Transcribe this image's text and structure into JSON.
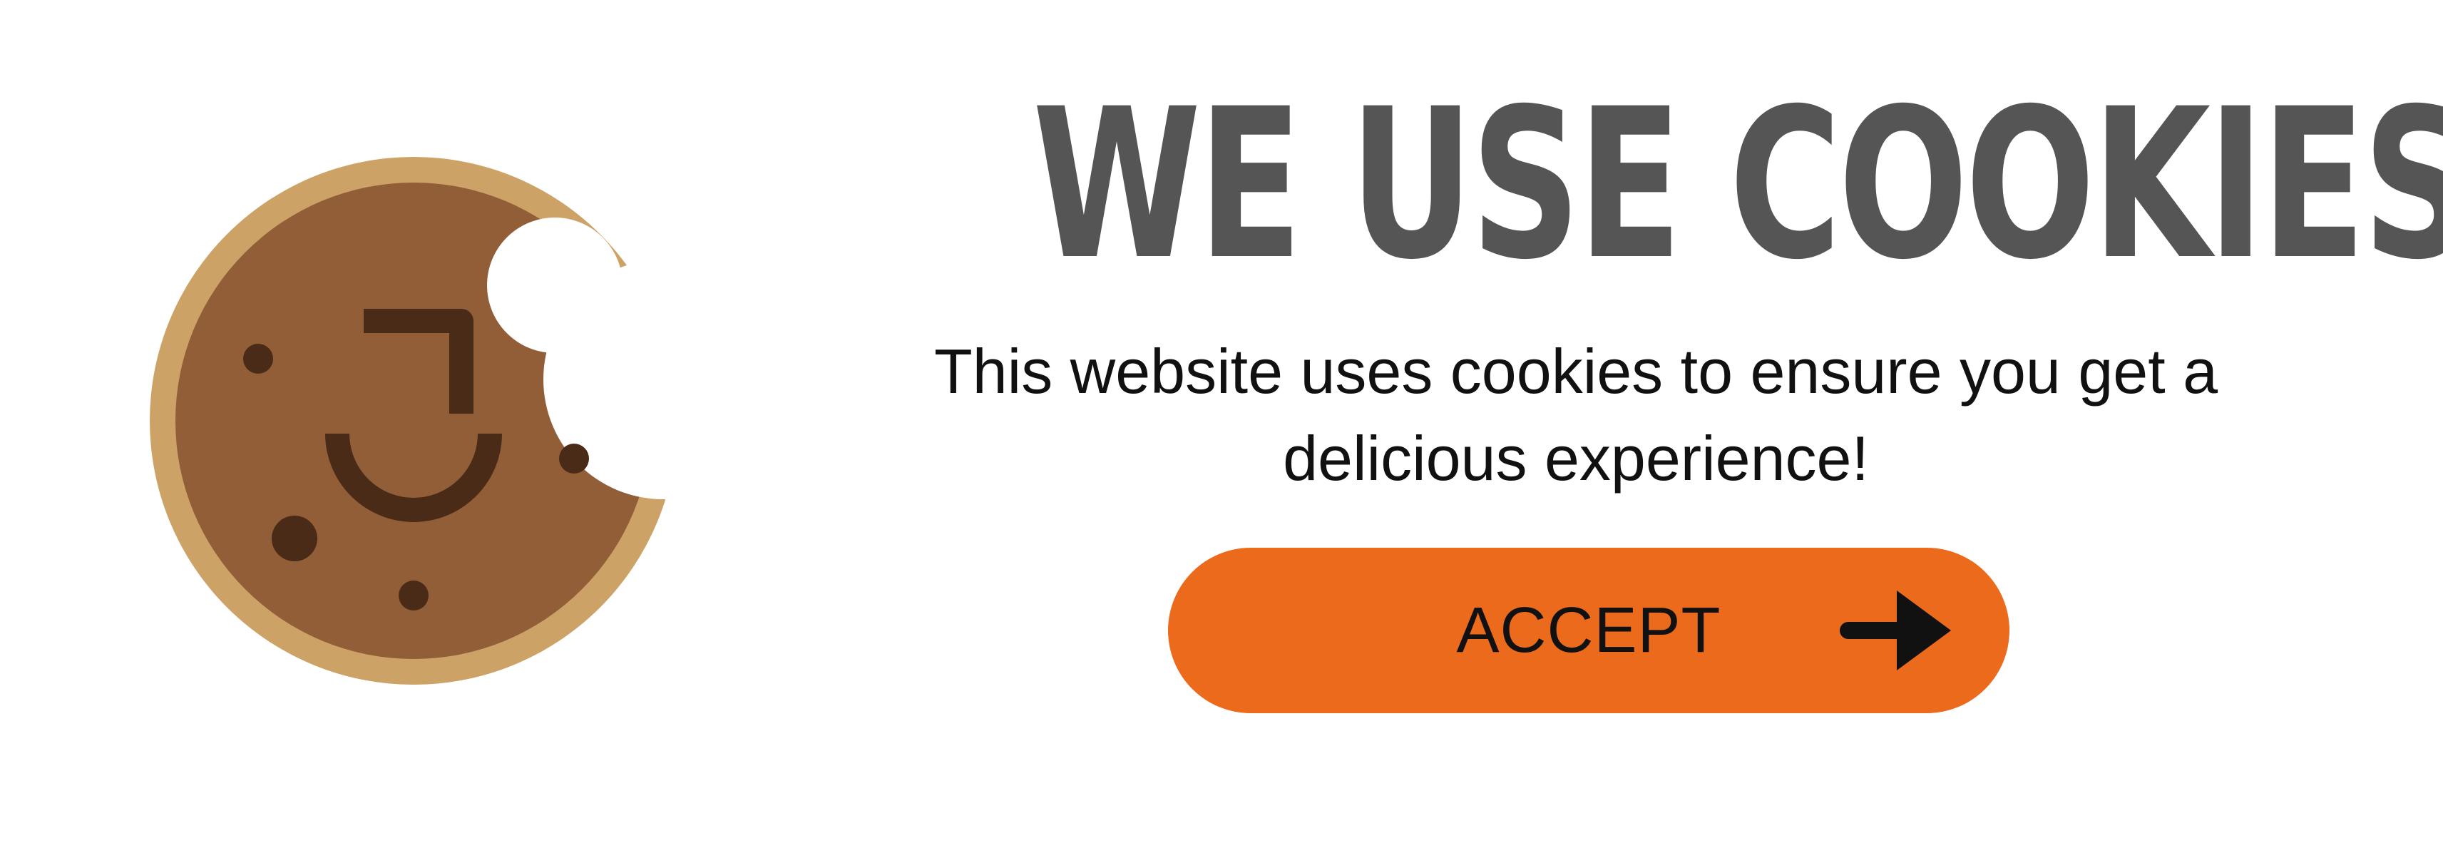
{
  "banner": {
    "title": "WE USE COOKIES",
    "message": "This website uses cookies to ensure you get a delicious experience!",
    "accept_label": "ACCEPT",
    "icons": {
      "illustration": "cookie-icon",
      "button_arrow": "arrow-right-icon"
    }
  },
  "colors": {
    "headline": "#555555",
    "message": "#111111",
    "button_bg": "#EB6A1C",
    "button_text": "#111111",
    "cookie_rim": "#CCA266",
    "cookie_body": "#925E38",
    "cookie_chips": "#492B18"
  }
}
